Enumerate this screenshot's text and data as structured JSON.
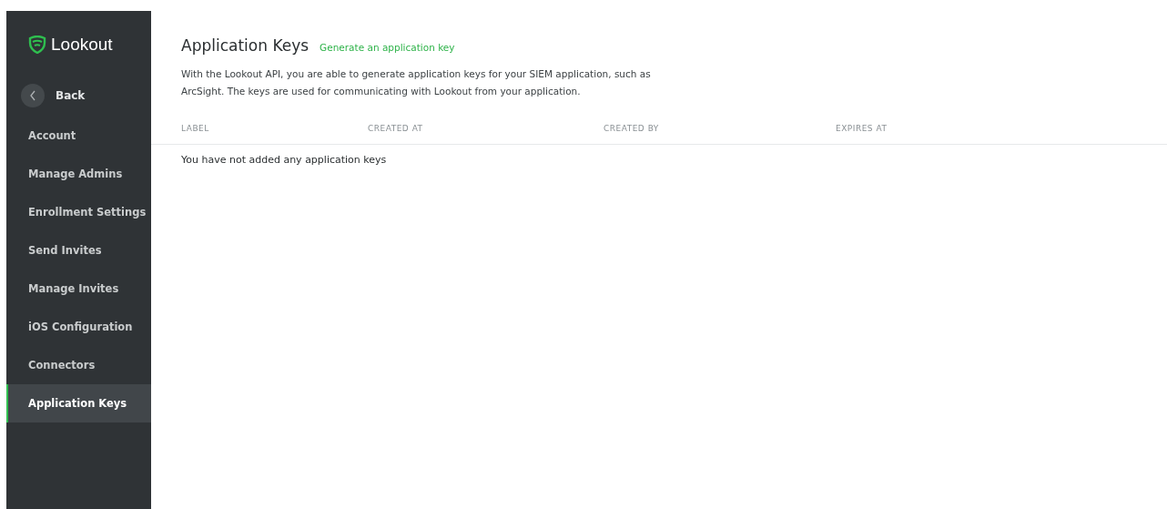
{
  "sidebar": {
    "logo": "Lookout",
    "back": "Back",
    "items": [
      {
        "label": "Account",
        "selected": false
      },
      {
        "label": "Manage Admins",
        "selected": false
      },
      {
        "label": "Enrollment Settings",
        "selected": false
      },
      {
        "label": "Send Invites",
        "selected": false
      },
      {
        "label": "Manage Invites",
        "selected": false
      },
      {
        "label": "iOS Configuration",
        "selected": false
      },
      {
        "label": "Connectors",
        "selected": false
      },
      {
        "label": "Application Keys",
        "selected": true
      }
    ]
  },
  "main": {
    "title": "Application Keys",
    "action_link": "Generate an application key",
    "description": "With the Lookout API, you are able to generate application keys for your SIEM application, such as ArcSight. The keys are used for communicating with Lookout from your application.",
    "table": {
      "columns": [
        "LABEL",
        "CREATED AT",
        "CREATED BY",
        "EXPIRES AT"
      ],
      "empty_message": "You have not added any application keys"
    }
  }
}
